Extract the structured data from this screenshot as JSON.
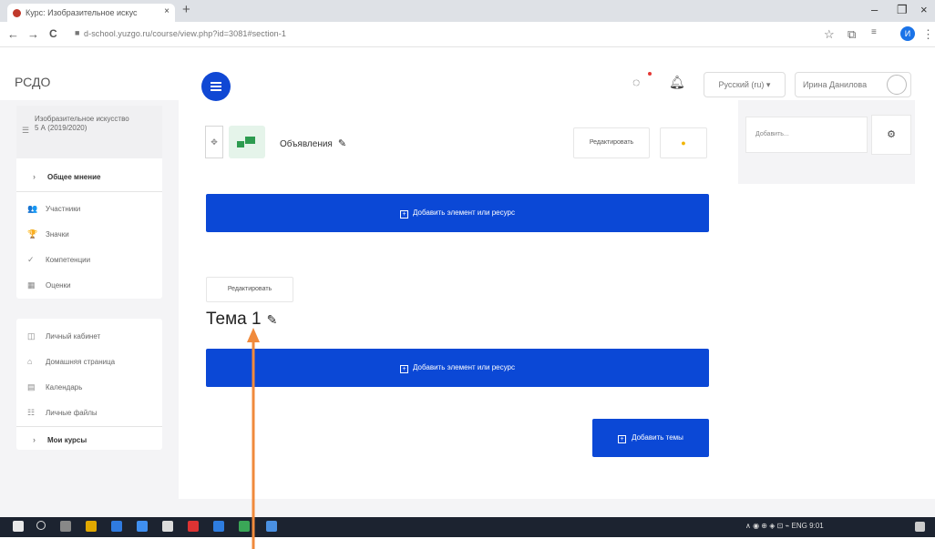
{
  "browser": {
    "tab_title": "Курс: Изобразительное искус",
    "tab_close": "×",
    "new_tab": "+",
    "window_controls": {
      "minimize": "–",
      "maximize": "❐",
      "close": "×"
    },
    "nav": {
      "back": "←",
      "forward": "→",
      "reload": "C",
      "lock": "🔒"
    },
    "url": "d-school.yuzgo.ru/course/view.php?id=3081#section-1",
    "profile_initial": "И",
    "tools": {
      "star": "☆",
      "extensions": "⧉",
      "menu": "⋮"
    }
  },
  "navbar": {
    "brand": "РСДО",
    "language": "Русский (ru) ▾",
    "user": "Ирина Данилова",
    "icons": {
      "messages": "messages-icon",
      "notifications": "bell-icon"
    }
  },
  "drawer": {
    "course_name": "Изобразительное искусство 5 А (2019/2020)",
    "general": "Общее мнение",
    "items": [
      {
        "icon": "participants-icon",
        "glyph": "👥",
        "label": "Участники"
      },
      {
        "icon": "badges-icon",
        "glyph": "🏆",
        "label": "Значки"
      },
      {
        "icon": "competencies-icon",
        "glyph": "✓",
        "label": "Компетенции"
      },
      {
        "icon": "grades-icon",
        "glyph": "▦",
        "label": "Оценки"
      }
    ],
    "site_items": [
      {
        "icon": "dashboard-icon",
        "glyph": "◫",
        "label": "Личный кабинет"
      },
      {
        "icon": "home-icon",
        "glyph": "⌂",
        "label": "Домашняя страница"
      },
      {
        "icon": "calendar-icon",
        "glyph": "▤",
        "label": "Календарь"
      },
      {
        "icon": "files-icon",
        "glyph": "☷",
        "label": "Личные файлы"
      }
    ],
    "my_courses": "Мои курсы"
  },
  "main": {
    "announcements": "Объявления",
    "edit_label": "Редактировать",
    "add_activity": "Добавить элемент или ресурс",
    "topic_edit_label": "Редактировать",
    "topic_title": "Тема 1",
    "add_topics": "Добавить темы"
  },
  "block": {
    "placeholder": "Добавить...",
    "gear": "⚙"
  },
  "taskbar": {
    "tray": "∧ ◉ ⊕ ◈ ⊡ ⌁ ENG 9:01"
  },
  "colors": {
    "primary": "#0b48d6",
    "drawer_bg": "#f4f4f6",
    "annotation": "#f08a3c"
  }
}
